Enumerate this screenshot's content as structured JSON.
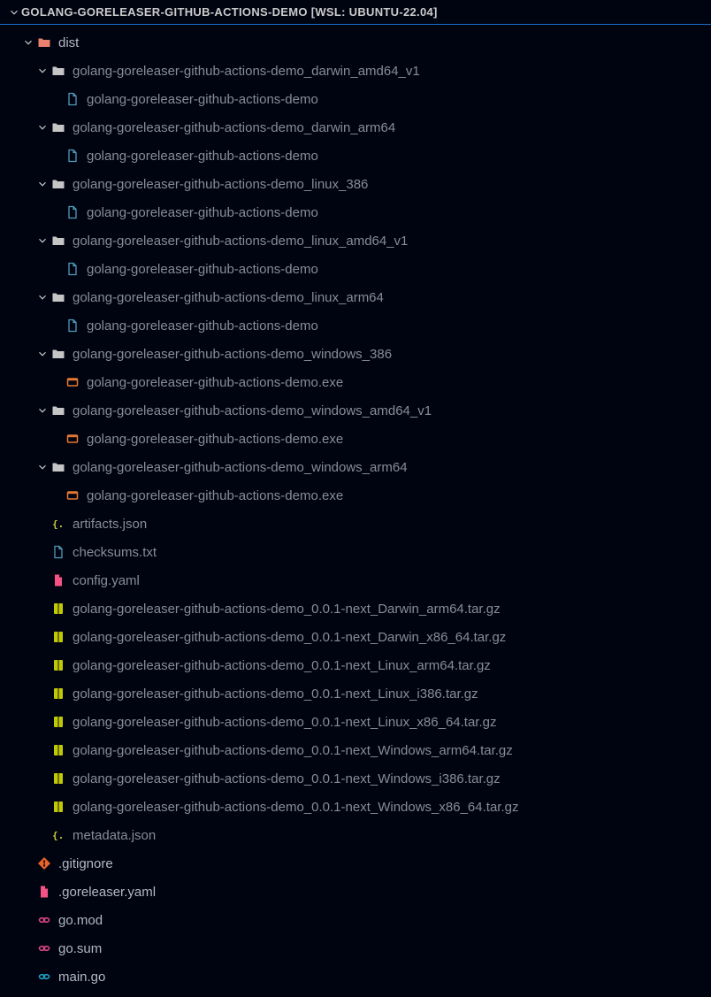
{
  "header": {
    "title": "GOLANG-GORELEASER-GITHUB-ACTIONS-DEMO [WSL: UBUNTU-22.04]"
  },
  "colors": {
    "folder": "#c5c5c5",
    "distFolder": "#e9816e",
    "goFile": "#519aba",
    "exeFile": "#e37933",
    "json": "#cbcb41",
    "txt": "#519aba",
    "yaml": "#f55385",
    "tgz": "#bfca04",
    "git": "#e8622a",
    "golink": "#e0478b",
    "gomain": "#1fa1c5",
    "chevron": "#cccccc"
  },
  "tree": [
    {
      "type": "folder",
      "name": "dist",
      "expanded": true,
      "depth": 0,
      "iconKind": "dist",
      "children": [
        {
          "type": "folder",
          "name": "golang-goreleaser-github-actions-demo_darwin_amd64_v1",
          "expanded": true,
          "depth": 1,
          "children": [
            {
              "type": "file",
              "name": "golang-goreleaser-github-actions-demo",
              "depth": 2,
              "iconKind": "gofile"
            }
          ]
        },
        {
          "type": "folder",
          "name": "golang-goreleaser-github-actions-demo_darwin_arm64",
          "expanded": true,
          "depth": 1,
          "children": [
            {
              "type": "file",
              "name": "golang-goreleaser-github-actions-demo",
              "depth": 2,
              "iconKind": "gofile"
            }
          ]
        },
        {
          "type": "folder",
          "name": "golang-goreleaser-github-actions-demo_linux_386",
          "expanded": true,
          "depth": 1,
          "children": [
            {
              "type": "file",
              "name": "golang-goreleaser-github-actions-demo",
              "depth": 2,
              "iconKind": "gofile"
            }
          ]
        },
        {
          "type": "folder",
          "name": "golang-goreleaser-github-actions-demo_linux_amd64_v1",
          "expanded": true,
          "depth": 1,
          "children": [
            {
              "type": "file",
              "name": "golang-goreleaser-github-actions-demo",
              "depth": 2,
              "iconKind": "gofile"
            }
          ]
        },
        {
          "type": "folder",
          "name": "golang-goreleaser-github-actions-demo_linux_arm64",
          "expanded": true,
          "depth": 1,
          "children": [
            {
              "type": "file",
              "name": "golang-goreleaser-github-actions-demo",
              "depth": 2,
              "iconKind": "gofile"
            }
          ]
        },
        {
          "type": "folder",
          "name": "golang-goreleaser-github-actions-demo_windows_386",
          "expanded": true,
          "depth": 1,
          "children": [
            {
              "type": "file",
              "name": "golang-goreleaser-github-actions-demo.exe",
              "depth": 2,
              "iconKind": "exe"
            }
          ]
        },
        {
          "type": "folder",
          "name": "golang-goreleaser-github-actions-demo_windows_amd64_v1",
          "expanded": true,
          "depth": 1,
          "children": [
            {
              "type": "file",
              "name": "golang-goreleaser-github-actions-demo.exe",
              "depth": 2,
              "iconKind": "exe"
            }
          ]
        },
        {
          "type": "folder",
          "name": "golang-goreleaser-github-actions-demo_windows_arm64",
          "expanded": true,
          "depth": 1,
          "children": [
            {
              "type": "file",
              "name": "golang-goreleaser-github-actions-demo.exe",
              "depth": 2,
              "iconKind": "exe"
            }
          ]
        },
        {
          "type": "file",
          "name": "artifacts.json",
          "depth": 1,
          "iconKind": "json"
        },
        {
          "type": "file",
          "name": "checksums.txt",
          "depth": 1,
          "iconKind": "txt"
        },
        {
          "type": "file",
          "name": "config.yaml",
          "depth": 1,
          "iconKind": "yaml"
        },
        {
          "type": "file",
          "name": "golang-goreleaser-github-actions-demo_0.0.1-next_Darwin_arm64.tar.gz",
          "depth": 1,
          "iconKind": "tgz"
        },
        {
          "type": "file",
          "name": "golang-goreleaser-github-actions-demo_0.0.1-next_Darwin_x86_64.tar.gz",
          "depth": 1,
          "iconKind": "tgz"
        },
        {
          "type": "file",
          "name": "golang-goreleaser-github-actions-demo_0.0.1-next_Linux_arm64.tar.gz",
          "depth": 1,
          "iconKind": "tgz"
        },
        {
          "type": "file",
          "name": "golang-goreleaser-github-actions-demo_0.0.1-next_Linux_i386.tar.gz",
          "depth": 1,
          "iconKind": "tgz"
        },
        {
          "type": "file",
          "name": "golang-goreleaser-github-actions-demo_0.0.1-next_Linux_x86_64.tar.gz",
          "depth": 1,
          "iconKind": "tgz"
        },
        {
          "type": "file",
          "name": "golang-goreleaser-github-actions-demo_0.0.1-next_Windows_arm64.tar.gz",
          "depth": 1,
          "iconKind": "tgz"
        },
        {
          "type": "file",
          "name": "golang-goreleaser-github-actions-demo_0.0.1-next_Windows_i386.tar.gz",
          "depth": 1,
          "iconKind": "tgz"
        },
        {
          "type": "file",
          "name": "golang-goreleaser-github-actions-demo_0.0.1-next_Windows_x86_64.tar.gz",
          "depth": 1,
          "iconKind": "tgz"
        },
        {
          "type": "file",
          "name": "metadata.json",
          "depth": 1,
          "iconKind": "json"
        }
      ]
    },
    {
      "type": "file",
      "name": ".gitignore",
      "depth": 0,
      "iconKind": "git"
    },
    {
      "type": "file",
      "name": ".goreleaser.yaml",
      "depth": 0,
      "iconKind": "yaml"
    },
    {
      "type": "file",
      "name": "go.mod",
      "depth": 0,
      "iconKind": "golink"
    },
    {
      "type": "file",
      "name": "go.sum",
      "depth": 0,
      "iconKind": "golink"
    },
    {
      "type": "file",
      "name": "main.go",
      "depth": 0,
      "iconKind": "gomain"
    }
  ]
}
